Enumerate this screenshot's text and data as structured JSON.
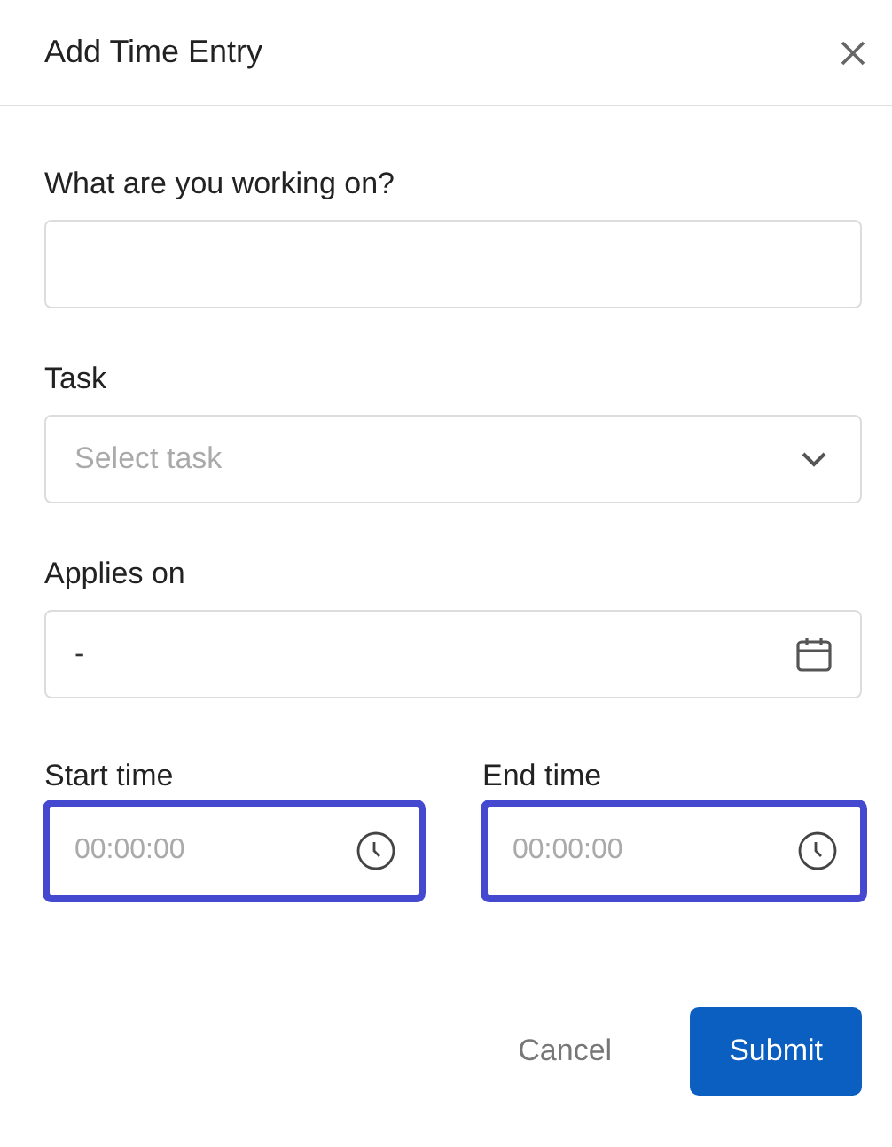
{
  "dialog": {
    "title": "Add Time Entry"
  },
  "description": {
    "label": "What are you working on?"
  },
  "task": {
    "label": "Task",
    "placeholder": "Select task"
  },
  "applies_on": {
    "label": "Applies on",
    "value": "-"
  },
  "time_fields": [
    {
      "label": "Start time",
      "placeholder": "00:00:00",
      "highlighted": true
    },
    {
      "label": "End time",
      "placeholder": "00:00:00",
      "highlighted": true
    }
  ],
  "buttons": [
    {
      "label": "Cancel",
      "kind": "text"
    },
    {
      "label": "Submit",
      "kind": "primary"
    }
  ]
}
